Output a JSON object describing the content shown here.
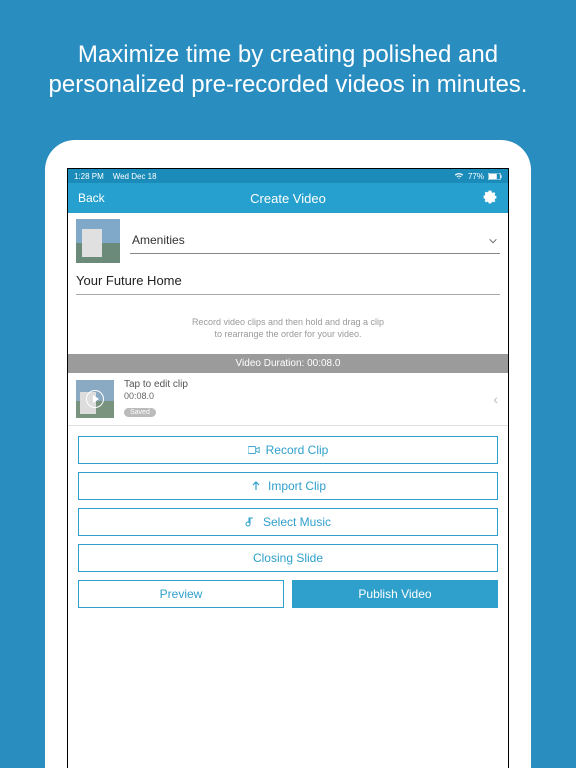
{
  "promo": {
    "headline": "Maximize time by creating polished and personalized pre-recorded videos in minutes."
  },
  "statusbar": {
    "time": "1:28 PM",
    "date": "Wed Dec 18",
    "battery": "77%"
  },
  "navbar": {
    "back": "Back",
    "title": "Create Video"
  },
  "category": {
    "selected": "Amenities"
  },
  "title_field": {
    "value": "Your Future Home"
  },
  "hint": {
    "line1": "Record video clips and then hold and drag a clip",
    "line2": "to rearrange the order for your video."
  },
  "duration_bar": "Video Duration: 00:08.0",
  "clip": {
    "label": "Tap to edit clip",
    "time": "00:08.0",
    "badge": "Saved"
  },
  "buttons": {
    "record": "Record Clip",
    "import": "Import Clip",
    "music": "Select Music",
    "closing": "Closing Slide",
    "preview": "Preview",
    "publish": "Publish Video"
  },
  "colors": {
    "bg": "#2a8dc0",
    "primary": "#2fa0cb"
  }
}
